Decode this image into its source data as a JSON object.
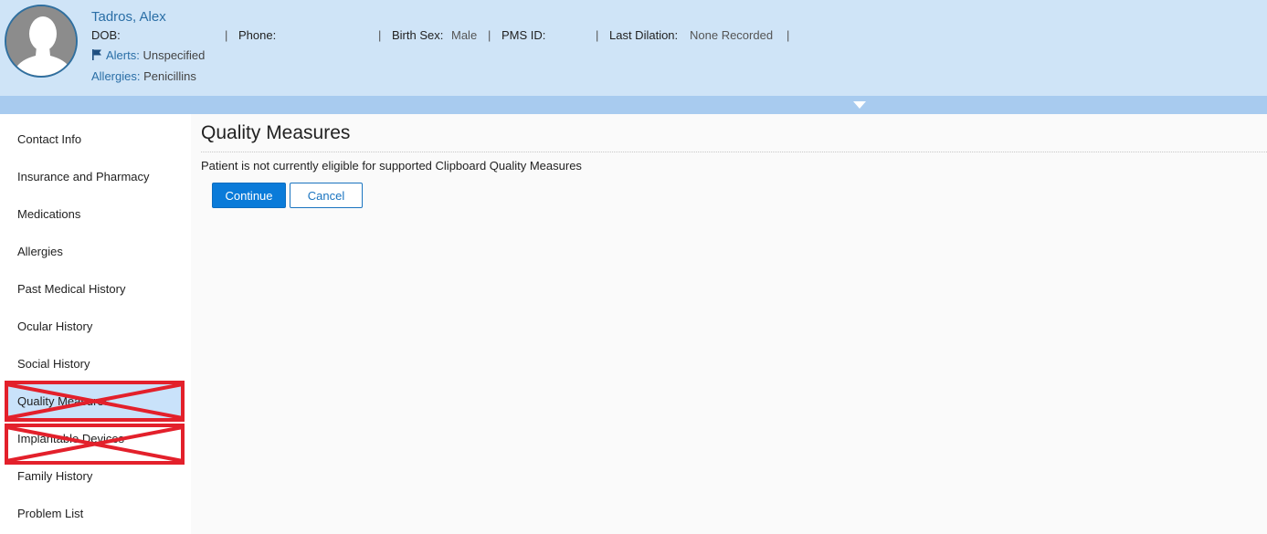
{
  "patient": {
    "name": "Tadros, Alex",
    "dob_label": "DOB:",
    "dob_value": "",
    "phone_label": "Phone:",
    "phone_value": "",
    "birth_sex_label": "Birth Sex:",
    "birth_sex_value": "Male",
    "pms_id_label": "PMS ID:",
    "pms_id_value": "",
    "last_dilation_label": "Last Dilation:",
    "last_dilation_value": "None Recorded",
    "separator": "|",
    "alerts_label": "Alerts:",
    "alerts_value": "Unspecified",
    "allergies_label": "Allergies:",
    "allergies_value": "Penicillins"
  },
  "sidebar": {
    "items": [
      {
        "label": "Contact Info"
      },
      {
        "label": "Insurance and Pharmacy"
      },
      {
        "label": "Medications"
      },
      {
        "label": "Allergies"
      },
      {
        "label": "Past Medical History"
      },
      {
        "label": "Ocular History"
      },
      {
        "label": "Social History"
      },
      {
        "label": "Quality Measures",
        "active": true,
        "crossed_out": true
      },
      {
        "label": "Implantable Devices",
        "crossed_out": true
      },
      {
        "label": "Family History"
      },
      {
        "label": "Problem List"
      }
    ]
  },
  "main": {
    "title": "Quality Measures",
    "message": "Patient is not currently eligible for supported Clipboard Quality Measures",
    "continue_label": "Continue",
    "cancel_label": "Cancel"
  },
  "icons": {
    "avatar": "user-silhouette-icon",
    "alert_flag": "flag-icon",
    "collapse": "caret-down-icon"
  },
  "colors": {
    "header_bg": "#cfe4f7",
    "accent_blue": "#2a6ea6",
    "primary_button": "#0a7bd9",
    "active_item": "#c9e2fa",
    "annotation_red": "#e3202b"
  }
}
